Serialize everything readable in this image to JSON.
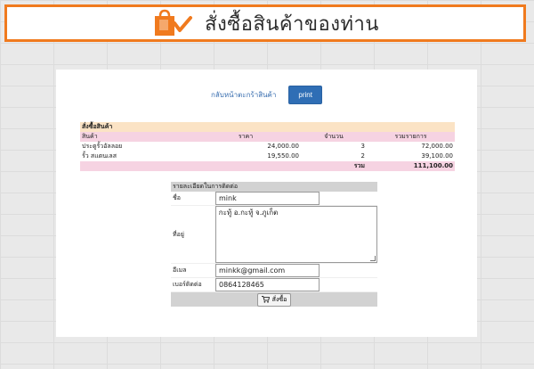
{
  "banner": {
    "title": "สั่งซื้อสินค้าของท่าน",
    "icon": "shopping-bag-check-icon",
    "accent_color": "#f07a1e"
  },
  "actions": {
    "back_link": "กลับหน้าตะกร้าสินค้า",
    "print_label": "print"
  },
  "order": {
    "section_title": "สั่งซื้อสินค้า",
    "columns": [
      "สินค้า",
      "ราคา",
      "จำนวน",
      "รวมรายการ"
    ],
    "items": [
      {
        "name": "ประตูรั้วอัลลอย",
        "price": "24,000.00",
        "qty": "3",
        "subtotal": "72,000.00"
      },
      {
        "name": "รั้ว สแตนเลส",
        "price": "19,550.00",
        "qty": "2",
        "subtotal": "39,100.00"
      }
    ],
    "total_label": "รวม",
    "total_value": "111,100.00"
  },
  "contact": {
    "section_title": "รายละเอียดในการติดต่อ",
    "name_label": "ชื่อ",
    "name_value": "mink",
    "address_label": "ที่อยู่",
    "address_value": "กะทู้ อ.กะทู้ จ.ภูเก็ต",
    "email_label": "อีเมล",
    "email_value": "minkk@gmail.com",
    "phone_label": "เบอร์ติดต่อ",
    "phone_value": "0864128465",
    "submit_label": "สั่งซื้อ",
    "submit_icon": "cart-icon"
  }
}
